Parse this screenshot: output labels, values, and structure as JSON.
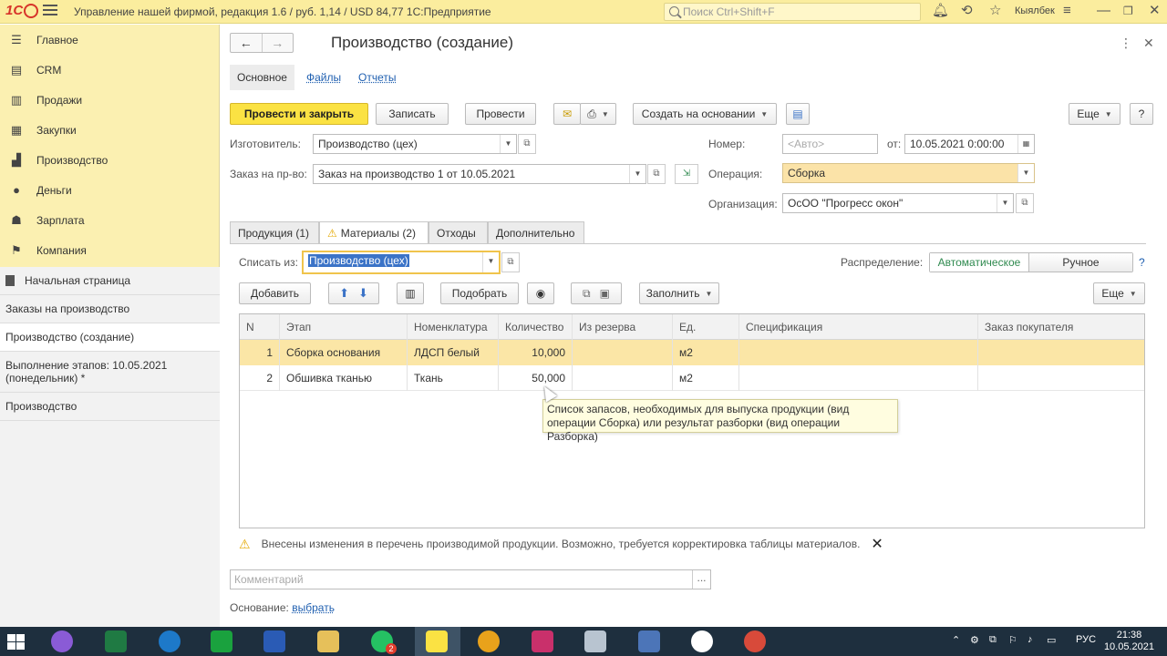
{
  "titlebar": {
    "app_title": "Управление нашей фирмой, редакция 1.6 / руб. 1,14 / USD 84,77 1С:Предприятие",
    "search_placeholder": "Поиск Ctrl+Shift+F",
    "user": "Кыялбек",
    "logo": "1С"
  },
  "sidebar": {
    "sections": [
      {
        "label": "Главное",
        "icon": "menu-icon"
      },
      {
        "label": "CRM",
        "icon": "crm-icon"
      },
      {
        "label": "Продажи",
        "icon": "sales-icon"
      },
      {
        "label": "Закупки",
        "icon": "purchases-icon"
      },
      {
        "label": "Производство",
        "icon": "production-icon"
      },
      {
        "label": "Деньги",
        "icon": "money-icon"
      },
      {
        "label": "Зарплата",
        "icon": "salary-icon"
      },
      {
        "label": "Компания",
        "icon": "company-flag-icon"
      }
    ],
    "open_windows": [
      {
        "label": "Начальная страница"
      },
      {
        "label": "Заказы на производство"
      },
      {
        "label": "Производство (создание)"
      },
      {
        "label": "Выполнение этапов: 10.05.2021 (понедельник) *"
      },
      {
        "label": "Производство"
      }
    ]
  },
  "form": {
    "title": "Производство (создание)",
    "tabs": [
      "Основное",
      "Файлы",
      "Отчеты"
    ],
    "toolbar": {
      "post_close": "Провести и закрыть",
      "save": "Записать",
      "post": "Провести",
      "create_based": "Создать на основании",
      "more": "Еще",
      "help": "?"
    },
    "fields": {
      "maker_label": "Изготовитель:",
      "maker_value": "Производство (цех)",
      "order_label": "Заказ на пр-во:",
      "order_value": "Заказ на производство 1 от 10.05.2021",
      "number_label": "Номер:",
      "number_placeholder": "<Авто>",
      "date_label": "от:",
      "date_value": "10.05.2021  0:00:00",
      "operation_label": "Операция:",
      "operation_value": "Сборка",
      "org_label": "Организация:",
      "org_value": "ОсОО \"Прогресс окон\""
    },
    "page_tabs": [
      "Продукция (1)",
      "Материалы (2)",
      "Отходы",
      "Дополнительно"
    ],
    "materials": {
      "writeoff_label": "Списать из:",
      "writeoff_value": "Производство (цех)",
      "distribution_label": "Распределение:",
      "distribution_auto": "Автоматическое",
      "distribution_manual": "Ручное",
      "help": "?",
      "add": "Добавить",
      "pick": "Подобрать",
      "fill": "Заполнить",
      "more": "Еще",
      "columns": [
        "N",
        "Этап",
        "Номенклатура",
        "Количество",
        "Из резерва",
        "Ед.",
        "Спецификация",
        "Заказ покупателя"
      ],
      "rows": [
        {
          "n": "1",
          "stage": "Сборка основания",
          "item": "ЛДСП белый",
          "qty": "10,000",
          "reserve": "",
          "unit": "м2",
          "spec": "",
          "order": ""
        },
        {
          "n": "2",
          "stage": "Обшивка тканью",
          "item": "Ткань",
          "qty": "50,000",
          "reserve": "",
          "unit": "м2",
          "spec": "",
          "order": ""
        }
      ],
      "tooltip_line1": "Список запасов, необходимых для выпуска продукции (вид",
      "tooltip_line2": "операции Сборка) или результат разборки (вид операции Разборка)"
    },
    "notice": "Внесены изменения в перечень производимой продукции. Возможно, требуется корректировка таблицы материалов.",
    "comment_placeholder": "Комментарий",
    "basis_label": "Основание:",
    "basis_link": "выбрать"
  },
  "taskbar": {
    "lang": "РУС",
    "time": "21:38",
    "date": "10.05.2021",
    "whatsapp_badge": "2"
  },
  "colors": {
    "titlebar": "#fbed9e",
    "sidebar": "#fbf0b1",
    "primary_button": "#fbe243",
    "selected_row": "#fbe6a6",
    "link": "#1f5fb0",
    "taskbar": "#1e2f3e"
  }
}
